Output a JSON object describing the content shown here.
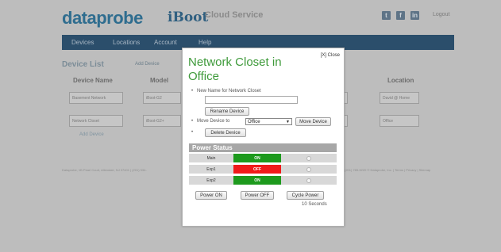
{
  "header": {
    "logo": "dataprobe",
    "product": "iBoot",
    "service": "Cloud Service",
    "logout": "Logout",
    "social_icons": [
      "twitter-icon",
      "facebook-icon",
      "linkedin-icon"
    ]
  },
  "nav": {
    "items": [
      "Devices",
      "Locations",
      "Account",
      "Help"
    ]
  },
  "content": {
    "title": "Device List",
    "add_device": "Add Device",
    "columns": [
      "Device Name",
      "Model",
      "Location"
    ],
    "rows": [
      {
        "name": "Basement Network",
        "model": "iBoot-G2",
        "location": "David @ Home"
      },
      {
        "name": "Network Closet",
        "model": "iBoot-G2+",
        "location": "Office"
      }
    ],
    "add_device_link": "Add Device",
    "footer_left": "Dataprobe, 1B Pearl Court, Allendale, NJ 07401 | (201) 934-",
    "footer_right": "(201) 785-5220 © Dataprobe, Inc. | Terms | Privacy | Sitemap"
  },
  "modal": {
    "close": "[X] Close",
    "title": "Network Closet in Office",
    "rename_label": "New Name for Network Closet",
    "rename_value": "",
    "rename_button": "Rename Device",
    "move_label": "Move Device to",
    "move_selected": "Office",
    "move_button": "Move Device",
    "delete_button": "Delete Device",
    "power_status_title": "Power Status",
    "outlets": [
      {
        "name": "Main",
        "state": "ON",
        "color": "#1d9a1d"
      },
      {
        "name": "Exp1",
        "state": "OFF",
        "color": "#f01a1a"
      },
      {
        "name": "Exp2",
        "state": "ON",
        "color": "#1d9a1d"
      }
    ],
    "power_on": "Power ON",
    "power_off": "Power OFF",
    "cycle_power": "Cycle Power",
    "cycle_seconds": "10 Seconds"
  }
}
